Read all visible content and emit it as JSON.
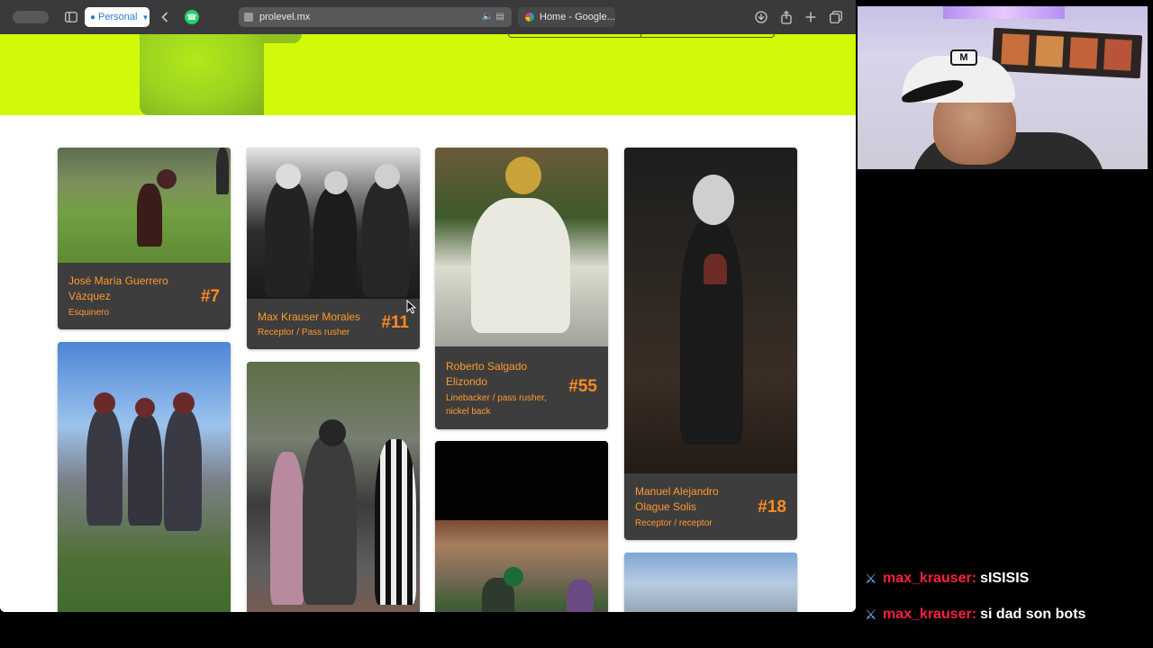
{
  "browser": {
    "profile_label": "Personal",
    "address_url": "prolevel.mx",
    "second_tab_label": "Home - Google...",
    "icons": [
      "sidebar-icon",
      "back-icon",
      "whatsapp-icon",
      "download-icon",
      "share-icon",
      "new-tab-icon",
      "tabs-overview-icon"
    ]
  },
  "players": [
    {
      "name": "José María Guerrero Vázquez",
      "role": "Esquinero",
      "number": "#7"
    },
    {
      "name": "Max Krauser Morales",
      "role": "Receptor / Pass rusher",
      "number": "#11"
    },
    {
      "name": "Roberto Salgado Elizondo",
      "role": "Linebacker / pass rusher, nickel back",
      "number": "#55"
    },
    {
      "name": "Manuel Alejandro Olague Solis",
      "role": "Receptor / receptor",
      "number": "#18"
    }
  ],
  "chat": [
    {
      "user": "max_krauser:",
      "message": "sISISIS"
    },
    {
      "user": "max_krauser:",
      "message": "si dad son bots"
    }
  ],
  "colors": {
    "hero_accent": "#d0fa0a",
    "card_bg": "#3d3d3d",
    "card_text": "#ff9a2f",
    "chat_user": "#ff1f3f"
  }
}
